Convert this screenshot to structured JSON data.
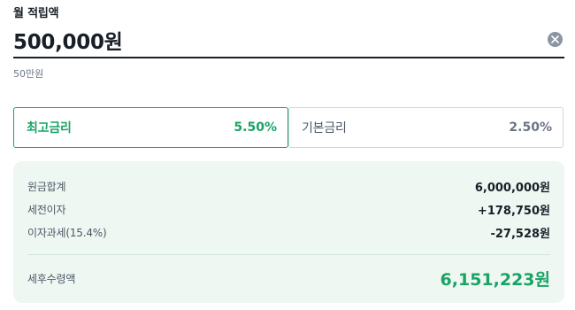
{
  "input": {
    "label": "월 적립액",
    "value": "500,000원",
    "hint": "50만원",
    "clear_icon": "close-circle-icon"
  },
  "rates": {
    "best": {
      "label": "최고금리",
      "value": "5.50%",
      "selected": true
    },
    "base": {
      "label": "기본금리",
      "value": "2.50%",
      "selected": false
    }
  },
  "summary": {
    "principal": {
      "label": "원금합계",
      "value": "6,000,000원"
    },
    "pretax_interest": {
      "label": "세전이자",
      "value": "+178,750원"
    },
    "interest_tax": {
      "label": "이자과세(15.4%)",
      "value": "-27,528원"
    },
    "after_tax_total": {
      "label": "세후수령액",
      "value": "6,151,223원"
    }
  },
  "colors": {
    "accent": "#1aa364",
    "summary_bg": "#eef7f1",
    "text": "#191f28",
    "muted": "#6b7684"
  }
}
